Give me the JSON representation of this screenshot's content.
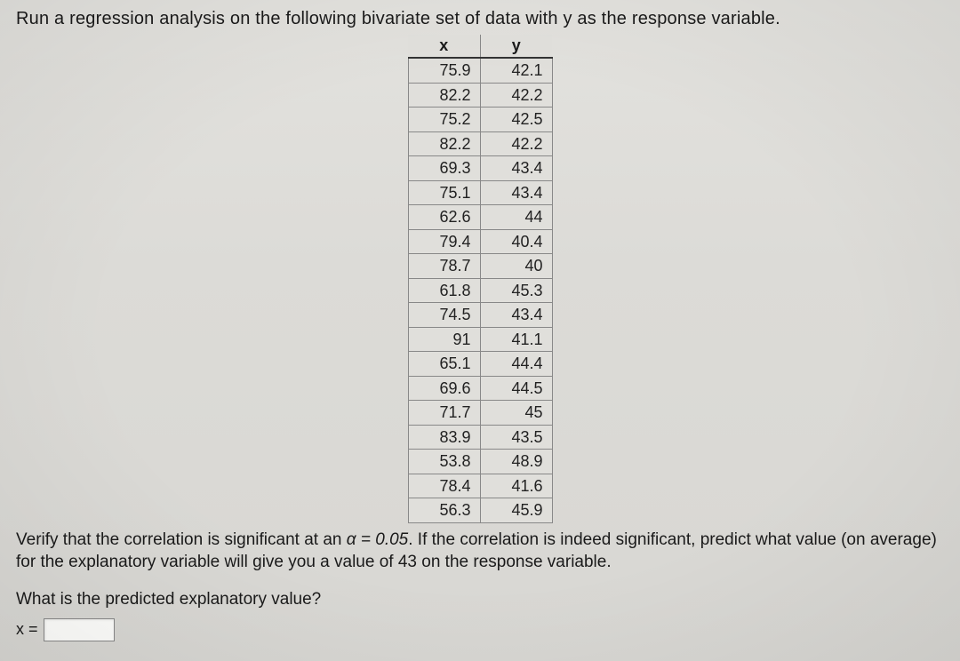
{
  "prompt_top": "Run a regression analysis on the following bivariate set of data with y as the response variable.",
  "table": {
    "headers": {
      "x": "x",
      "y": "y"
    },
    "rows": [
      {
        "x": "75.9",
        "y": "42.1"
      },
      {
        "x": "82.2",
        "y": "42.2"
      },
      {
        "x": "75.2",
        "y": "42.5"
      },
      {
        "x": "82.2",
        "y": "42.2"
      },
      {
        "x": "69.3",
        "y": "43.4"
      },
      {
        "x": "75.1",
        "y": "43.4"
      },
      {
        "x": "62.6",
        "y": "44"
      },
      {
        "x": "79.4",
        "y": "40.4"
      },
      {
        "x": "78.7",
        "y": "40"
      },
      {
        "x": "61.8",
        "y": "45.3"
      },
      {
        "x": "74.5",
        "y": "43.4"
      },
      {
        "x": "91",
        "y": "41.1"
      },
      {
        "x": "65.1",
        "y": "44.4"
      },
      {
        "x": "69.6",
        "y": "44.5"
      },
      {
        "x": "71.7",
        "y": "45"
      },
      {
        "x": "83.9",
        "y": "43.5"
      },
      {
        "x": "53.8",
        "y": "48.9"
      },
      {
        "x": "78.4",
        "y": "41.6"
      },
      {
        "x": "56.3",
        "y": "45.9"
      }
    ]
  },
  "prompt_bottom_1": "Verify that the correlation is significant at an ",
  "alpha_eq": "α = 0.05",
  "prompt_bottom_2": ". If the correlation is indeed significant, predict what value (on average) for the explanatory variable will give you a value of 43 on the response variable.",
  "question": "What is the predicted explanatory value?",
  "answer_label": "x =",
  "answer_value": "",
  "chart_data": {
    "type": "table",
    "title": "Bivariate data (x explanatory, y response)",
    "columns": [
      "x",
      "y"
    ],
    "rows": [
      [
        75.9,
        42.1
      ],
      [
        82.2,
        42.2
      ],
      [
        75.2,
        42.5
      ],
      [
        82.2,
        42.2
      ],
      [
        69.3,
        43.4
      ],
      [
        75.1,
        43.4
      ],
      [
        62.6,
        44
      ],
      [
        79.4,
        40.4
      ],
      [
        78.7,
        40
      ],
      [
        61.8,
        45.3
      ],
      [
        74.5,
        43.4
      ],
      [
        91,
        41.1
      ],
      [
        65.1,
        44.4
      ],
      [
        69.6,
        44.5
      ],
      [
        71.7,
        45
      ],
      [
        83.9,
        43.5
      ],
      [
        53.8,
        48.9
      ],
      [
        78.4,
        41.6
      ],
      [
        56.3,
        45.9
      ]
    ]
  }
}
